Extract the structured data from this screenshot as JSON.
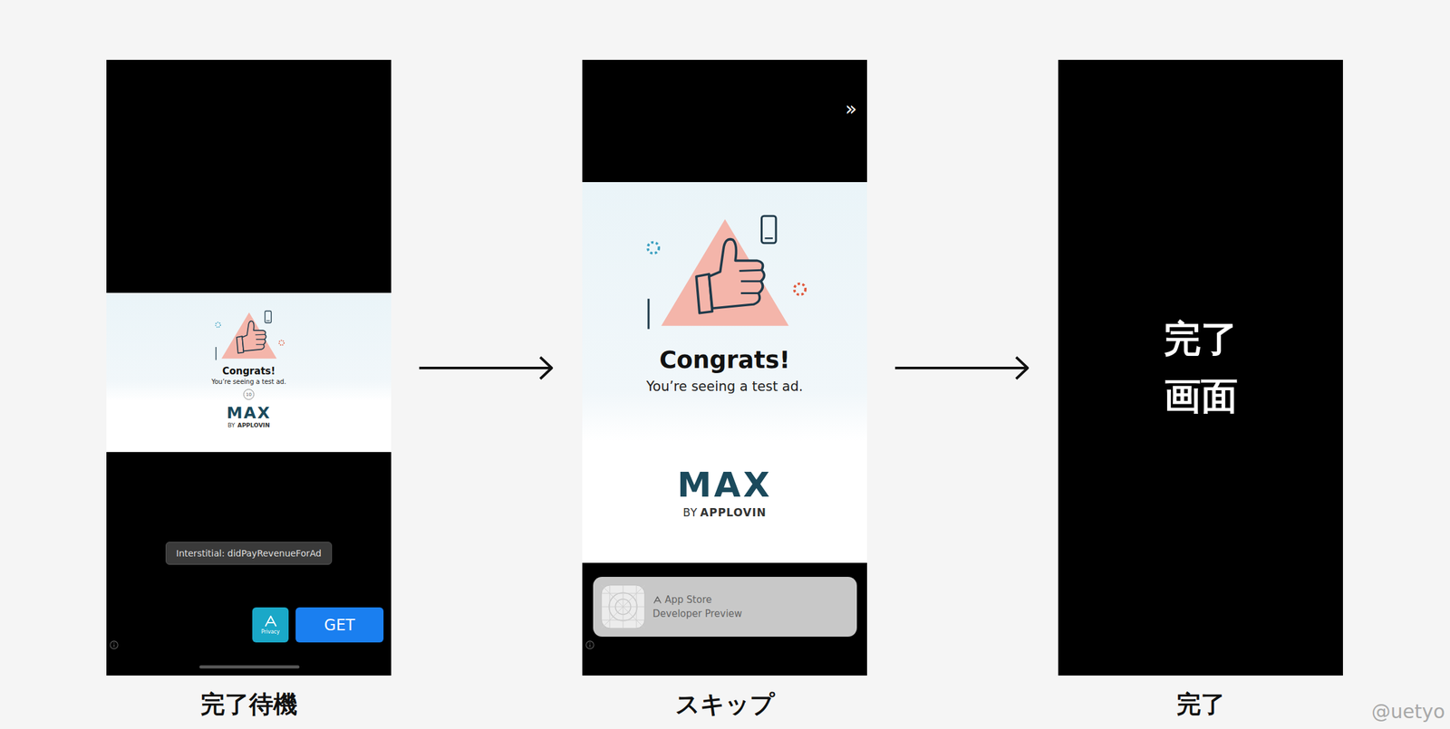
{
  "stages": [
    {
      "kind": "waiting",
      "label": "完了待機",
      "ad": {
        "title": "Congrats!",
        "subtitle": "You’re seeing a test ad.",
        "countdown": "10",
        "logo": "MAX",
        "byline_prefix": "BY",
        "byline_brand": "APPLOVIN"
      },
      "toast": "Interstitial: didPayRevenueForAd",
      "privacy": "Privacy",
      "get": "GET"
    },
    {
      "kind": "skip",
      "label": "スキップ",
      "skip": "»",
      "ad": {
        "title": "Congrats!",
        "subtitle": "You’re seeing a test ad.",
        "logo": "MAX",
        "byline_prefix": "BY",
        "byline_brand": "APPLOVIN"
      },
      "banner": {
        "source": "App Store",
        "caption": "Developer Preview"
      }
    },
    {
      "kind": "done",
      "label": "完了",
      "lines": [
        "完了",
        "画面"
      ]
    }
  ],
  "watermark": "@uetyo"
}
